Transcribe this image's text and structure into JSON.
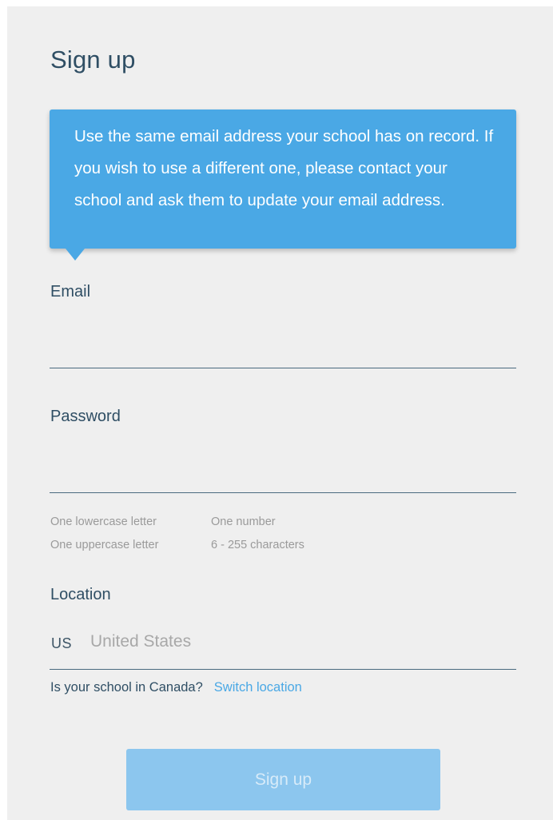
{
  "title": "Sign up",
  "notice": "Use the same email address your school has on record. If you wish to use a different one, please contact your school and ask them to update your email address.",
  "email": {
    "label": "Email",
    "value": ""
  },
  "password": {
    "label": "Password",
    "value": "",
    "requirements": [
      "One lowercase letter",
      "One number",
      "One uppercase letter",
      "6 - 255 characters"
    ]
  },
  "location": {
    "label": "Location",
    "code": "US",
    "name": "United States"
  },
  "canada_prompt": {
    "question": "Is your school in Canada?",
    "link": "Switch location"
  },
  "submit_label": "Sign up",
  "colors": {
    "accent": "#4aa8e5",
    "heading": "#2f4e64",
    "button_disabled": "#8cc6ee"
  }
}
